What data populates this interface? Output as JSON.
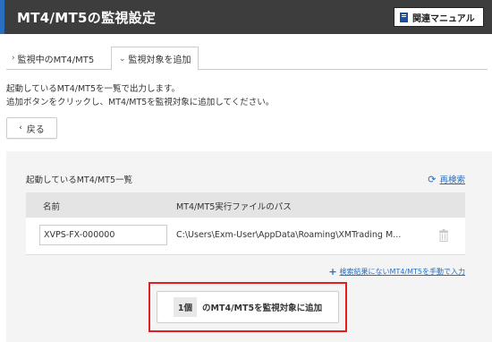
{
  "header": {
    "title": "MT4/MT5の監視設定",
    "manual_label": "関連マニュアル"
  },
  "tabs": [
    {
      "label": "監視中のMT4/MT5",
      "active": false
    },
    {
      "label": "監視対象を追加",
      "active": true
    }
  ],
  "description": {
    "line1": "起動しているMT4/MT5を一覧で出力します。",
    "line2": "追加ボタンをクリックし、MT4/MT5を監視対象に追加してください。"
  },
  "back_label": "戻る",
  "panel": {
    "title": "起動しているMT4/MT5一覧",
    "refresh_label": "再検索",
    "columns": {
      "name": "名前",
      "path": "MT4/MT5実行ファイルのパス"
    },
    "rows": [
      {
        "name": "XVPS-FX-000000",
        "path": "C:\\Users\\Exm-User\\AppData\\Roaming\\XMTrading M..."
      }
    ],
    "manual_add_label": "検索結果にないMT4/MT5を手動で入力",
    "add_count": "1個",
    "add_label": "のMT4/MT5を監視対象に追加"
  },
  "colors": {
    "accent": "#2a6fbf",
    "header_bg": "#3d3d3d",
    "highlight": "#e02020"
  }
}
